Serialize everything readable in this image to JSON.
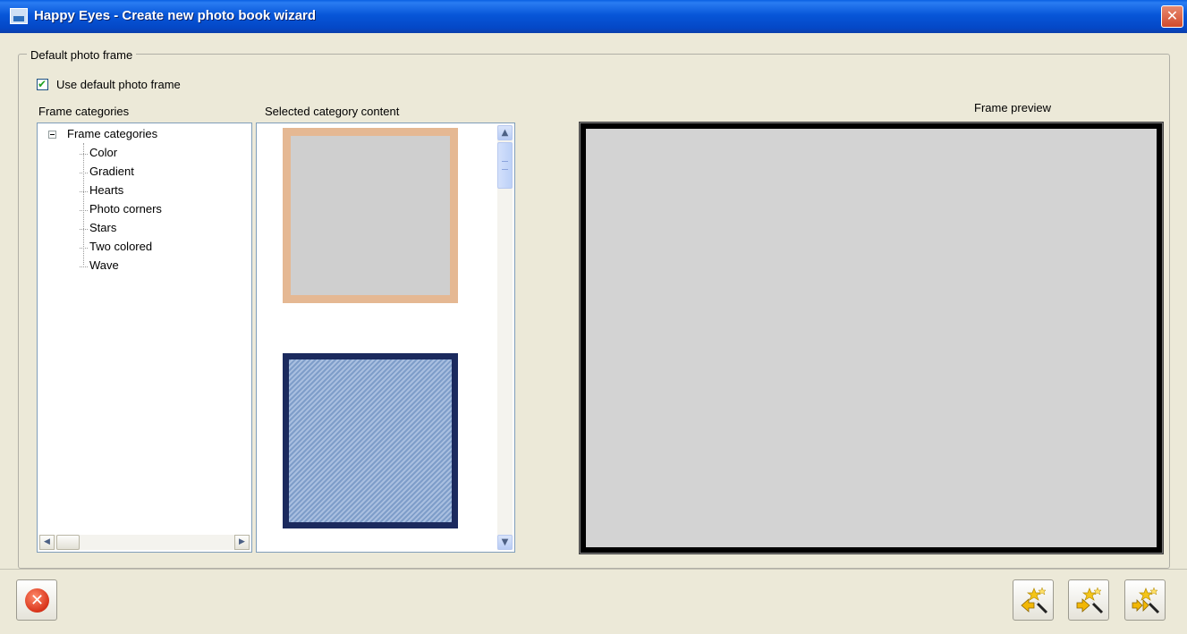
{
  "window": {
    "title": "Happy Eyes - Create new photo book wizard",
    "close_glyph": "✕"
  },
  "group": {
    "legend": "Default photo frame",
    "use_default_label": "Use default photo frame",
    "use_default_checked": true
  },
  "labels": {
    "frame_categories": "Frame categories",
    "selected_content": "Selected category content",
    "frame_preview": "Frame preview"
  },
  "tree": {
    "root": "Frame categories",
    "items": [
      "Color",
      "Gradient",
      "Hearts",
      "Photo corners",
      "Stars",
      "Two colored",
      "Wave"
    ]
  },
  "thumbnails": [
    {
      "name": "beige-frame",
      "border_color": "#E5B893",
      "fill": "#CFCFCF"
    },
    {
      "name": "navy-pattern-frame",
      "border_color": "#1B2A5E",
      "fill": "#9AB3DA"
    }
  ],
  "preview": {
    "border_color": "#000000",
    "fill": "#D3D3D3"
  },
  "icons": {
    "cancel": "x-circle-icon",
    "back": "wand-arrow-left-icon",
    "next": "wand-arrow-right-icon",
    "finish": "wand-double-arrow-icon"
  },
  "colors": {
    "titlebar": "#0756D8",
    "background": "#ECE9D8"
  }
}
